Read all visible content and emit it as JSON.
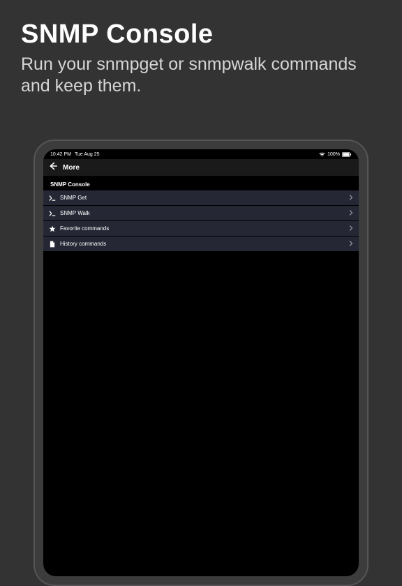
{
  "promo": {
    "title": "SNMP Console",
    "subtitle": "Run your snmpget or snmpwalk commands and keep them."
  },
  "status": {
    "time": "10:42 PM",
    "date": "Tue Aug 25",
    "battery_pct": "100%"
  },
  "nav": {
    "back_icon": "arrow-left",
    "title": "More"
  },
  "section": {
    "header": "SNMP Console"
  },
  "items": [
    {
      "icon": "prompt",
      "label": "SNMP Get"
    },
    {
      "icon": "prompt",
      "label": "SNMP Walk"
    },
    {
      "icon": "star",
      "label": "Favorite commands"
    },
    {
      "icon": "doc",
      "label": "History commands"
    }
  ]
}
